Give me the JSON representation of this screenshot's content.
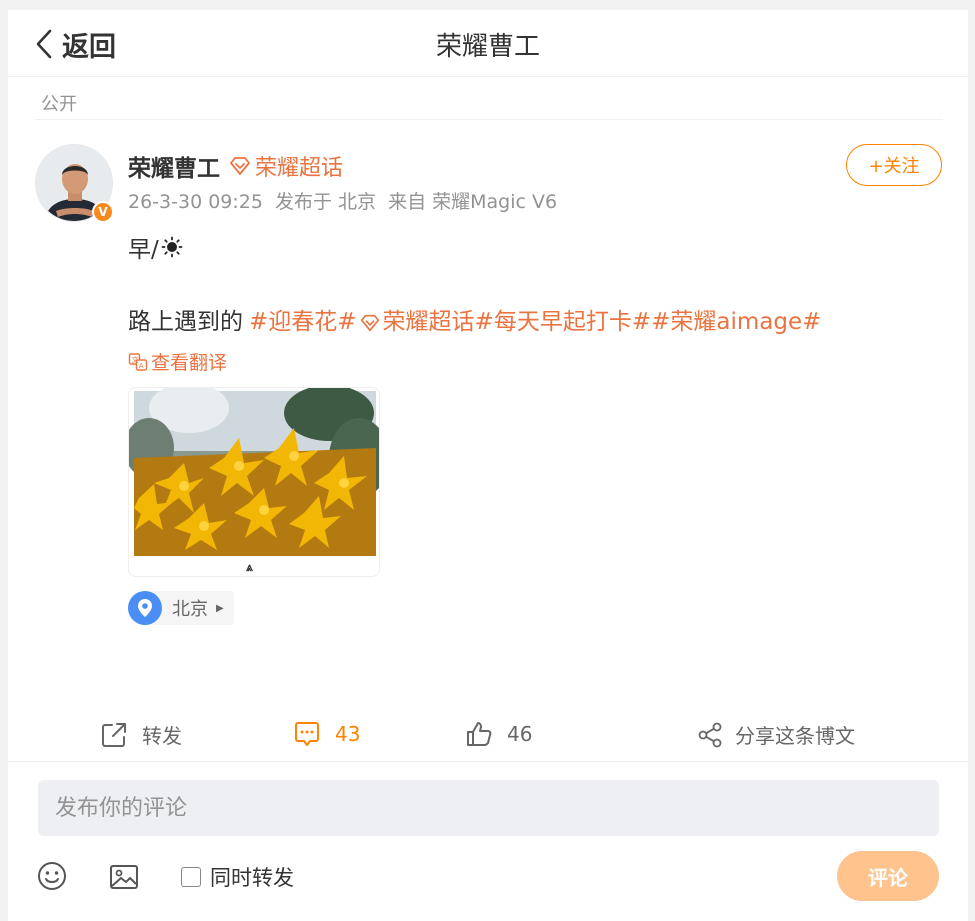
{
  "header": {
    "back_label": "返回",
    "title": "荣耀曹工"
  },
  "post": {
    "visibility": "公开",
    "author": {
      "name": "荣耀曹工",
      "supertopic": "荣耀超话",
      "badge": "V"
    },
    "follow_label": "+关注",
    "meta": {
      "time": "26-3-30 09:25",
      "location_text": "发布于 北京",
      "source": "来自 荣耀Magic V6"
    },
    "text_line1": "早/",
    "text_line2_prefix": "路上遇到的",
    "tags": {
      "tag1": "#迎春花#",
      "tag2_label": "荣耀超话",
      "tag3": "#每天早起打卡#",
      "tag4": "#荣耀aimage#"
    },
    "translate_label": "查看翻译",
    "location_label": "北京"
  },
  "actions": {
    "repost_label": "转发",
    "comment_count": "43",
    "like_count": "46",
    "share_label": "分享这条博文"
  },
  "comment_box": {
    "placeholder": "发布你的评论",
    "repost_label": "同时转发",
    "submit_label": "评论"
  },
  "colors": {
    "accent": "#ff8200",
    "tag": "#eb7340",
    "submit_disabled": "#ffc48e",
    "location_pin": "#4a8ef5"
  },
  "icons": [
    "back-chevron-icon",
    "supertopic-diamond-icon",
    "sun-icon",
    "translate-icon",
    "location-pin-icon",
    "repost-icon",
    "comment-icon",
    "like-icon",
    "share-icon",
    "emoji-icon",
    "image-icon"
  ]
}
